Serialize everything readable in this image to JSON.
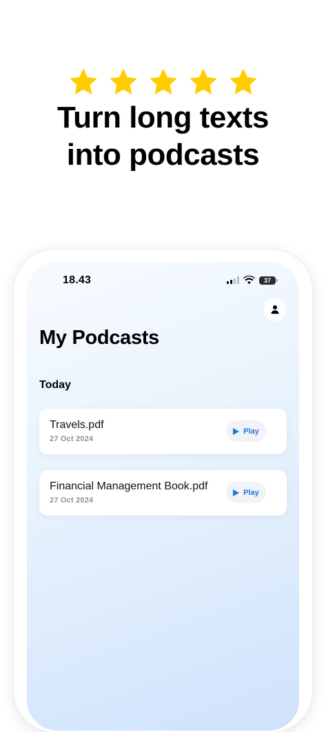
{
  "rating": {
    "stars": 5,
    "star_color": "#ffcc00"
  },
  "headline": {
    "line1": "Turn long texts",
    "line2": "into podcasts"
  },
  "status_bar": {
    "time": "18.43",
    "battery": "37"
  },
  "page": {
    "title": "My Podcasts",
    "section": "Today"
  },
  "podcasts": [
    {
      "title": "Travels.pdf",
      "date": "27 Oct 2024",
      "action": "Play"
    },
    {
      "title": "Financial Management Book.pdf",
      "date": "27 Oct 2024",
      "action": "Play"
    }
  ],
  "colors": {
    "accent": "#1f7ae0",
    "background_top": "#f6fbfe",
    "background_bottom": "#cfe2fc"
  },
  "icons": {
    "profile": "person-icon",
    "play": "play-icon",
    "rating": "star-icon"
  }
}
